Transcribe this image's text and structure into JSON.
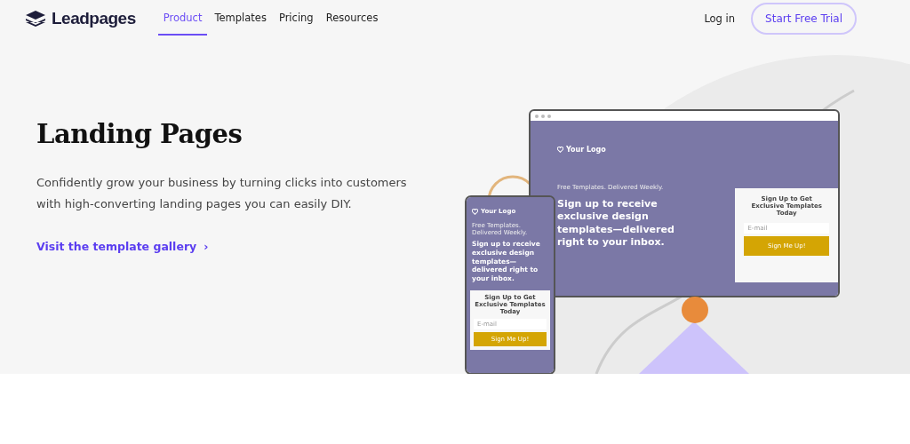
{
  "nav": {
    "brand": "Leadpages",
    "links": [
      {
        "label": "Product",
        "selected": true
      },
      {
        "label": "Templates",
        "selected": false
      },
      {
        "label": "Pricing",
        "selected": false
      },
      {
        "label": "Resources",
        "selected": false
      }
    ],
    "login": "Log in",
    "cta": "Start Free Trial"
  },
  "hero": {
    "title": "Landing Pages",
    "description": "Confidently grow your business by turning clicks into customers with high-converting landing pages you can easily DIY.",
    "link": "Visit the template gallery",
    "link_icon": "›"
  },
  "mockups": [
    {
      "kind": "desktop",
      "logo": "Your Logo",
      "kicker": "Free Templates. Delivered Weekly.",
      "headline": "Sign up to receive exclusive design templates—delivered right to your inbox.",
      "form_title": "Sign Up to Get Exclusive Templates Today",
      "placeholder": "E-mail",
      "button": "Sign Me Up!"
    },
    {
      "kind": "phone",
      "logo": "Your Logo",
      "kicker": "Free Templates. Delivered Weekly.",
      "headline": "Sign up to receive exclusive design templates—delivered right to your inbox.",
      "form_title": "Sign Up to Get Exclusive Templates Today",
      "placeholder": "E-mail",
      "button": "Sign Me Up!"
    }
  ]
}
